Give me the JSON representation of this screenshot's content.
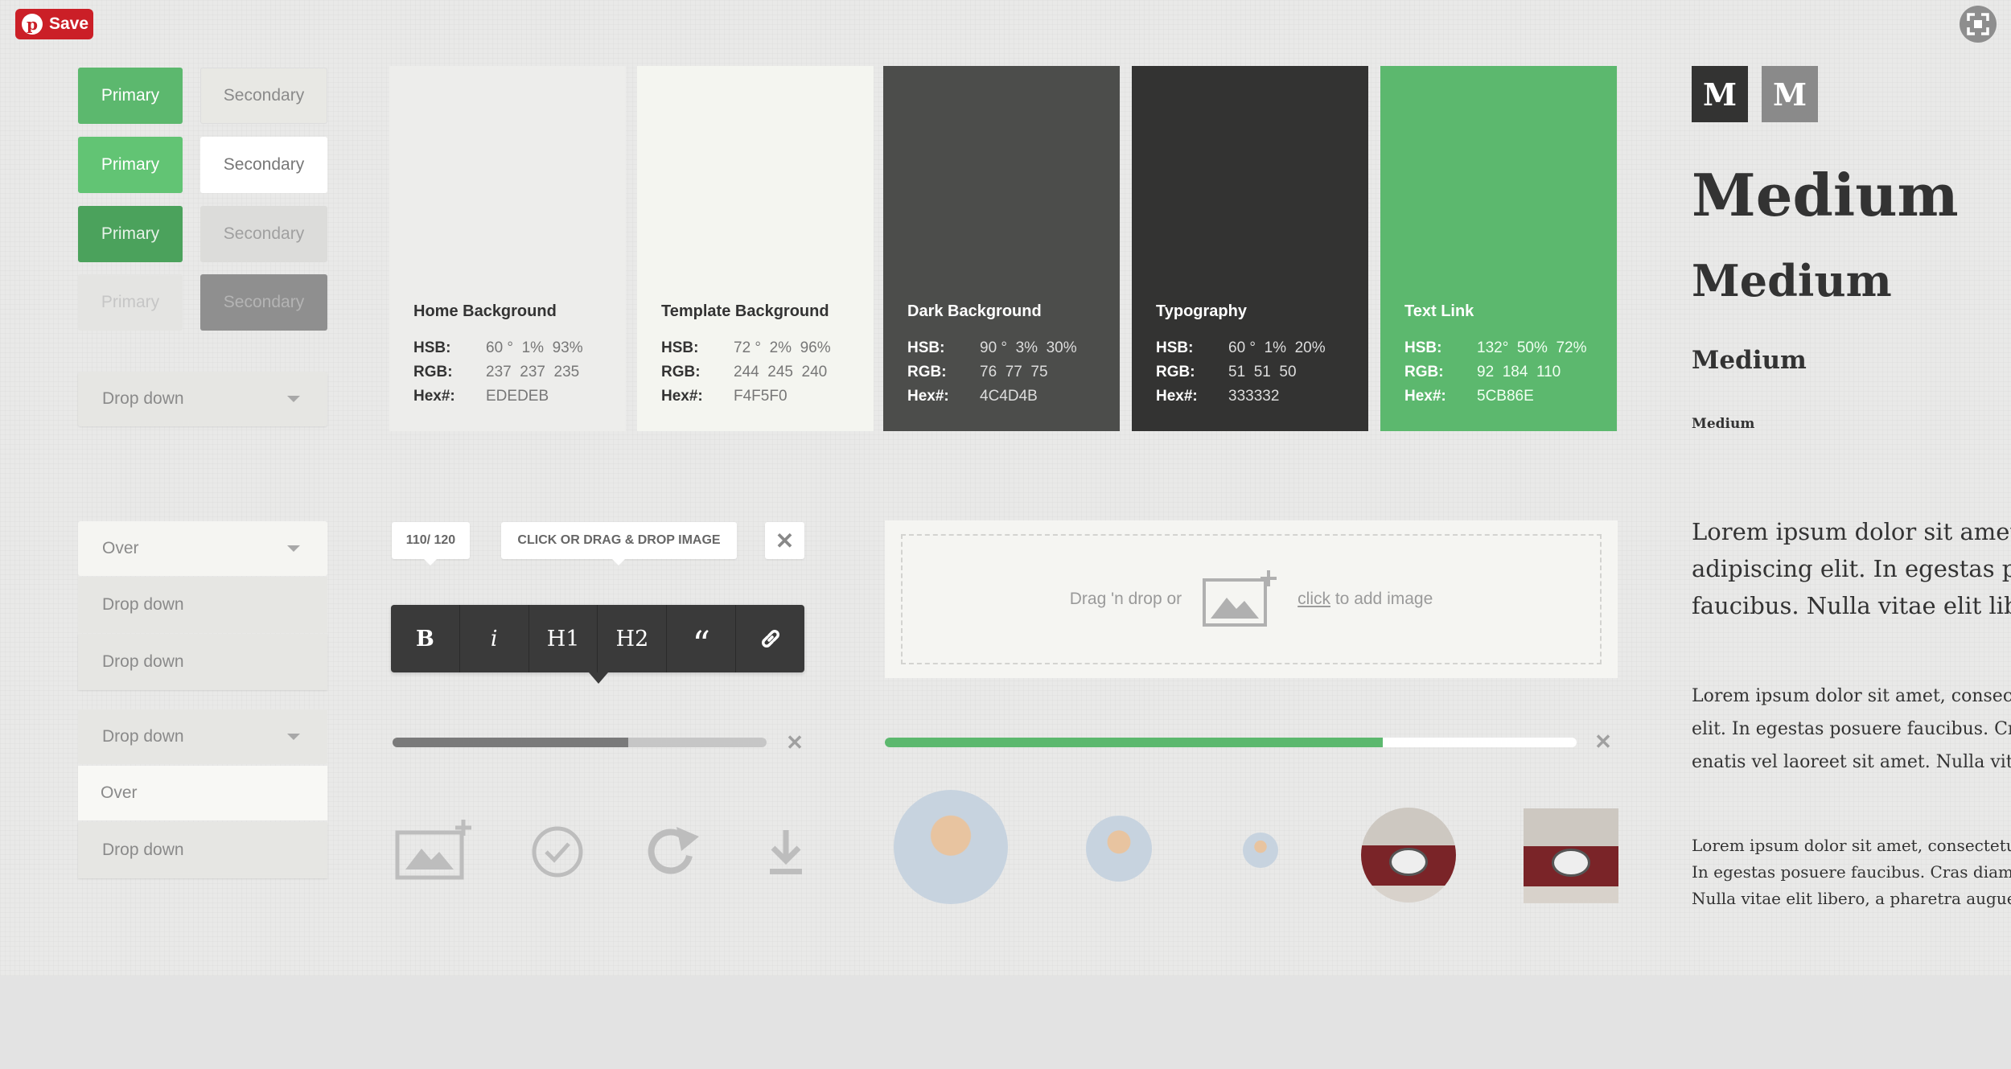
{
  "pinterest": {
    "save_label": "Save"
  },
  "buttons": [
    {
      "primary": "Primary",
      "secondary": "Secondary"
    },
    {
      "primary": "Primary",
      "secondary": "Secondary"
    },
    {
      "primary": "Primary",
      "secondary": "Secondary"
    },
    {
      "primary": "Primary",
      "secondary": "Secondary"
    }
  ],
  "dropdowns": {
    "closed": "Drop down",
    "open_a": {
      "header": "Over",
      "items": [
        "Drop down",
        "Drop down"
      ]
    },
    "open_b": {
      "header": "Drop down",
      "items": [
        "Over",
        "Drop down"
      ]
    }
  },
  "swatches": [
    {
      "name": "Home Background",
      "hsb": "60 °  1%  93%",
      "rgb": "237  237  235",
      "hex": "EDEDEB",
      "color": "#EDEDEB"
    },
    {
      "name": "Template Background",
      "hsb": "72 °  2%  96%",
      "rgb": "244  245  240",
      "hex": "F4F5F0",
      "color": "#F4F5F0"
    },
    {
      "name": "Dark Background",
      "hsb": "90 °  3%  30%",
      "rgb": "76  77  75",
      "hex": "4C4D4B",
      "color": "#4C4D4B"
    },
    {
      "name": "Typography",
      "hsb": "60 °  1%  20%",
      "rgb": "51  51  50",
      "hex": "333332",
      "color": "#333332"
    },
    {
      "name": "Text Link",
      "hsb": "132°  50%  72%",
      "rgb": "92  184  110",
      "hex": "5CB86E",
      "color": "#5CB86E"
    }
  ],
  "swatch_labels": {
    "hsb": "HSB:",
    "rgb": "RGB:",
    "hex": "Hex#:"
  },
  "typography": {
    "logo_letter": "M",
    "headings": [
      "Medium",
      "Medium",
      "Medium",
      "Medium"
    ],
    "paragraphs": [
      "Lorem ipsum dolor sit amet, c",
      "adipiscing elit. In egestas pos",
      "faucibus. Nulla vitae elit liber"
    ],
    "paragraphs_md": [
      "Lorem ipsum dolor sit amet, consecte",
      "elit. In egestas posuere faucibus. Cra",
      "enatis vel laoreet sit amet. Nulla vita"
    ],
    "paragraphs_sm": [
      "Lorem ipsum dolor sit amet, consectetu",
      "In egestas posuere faucibus. Cras diam",
      "Nulla vitae elit libero, a pharetra augue"
    ]
  },
  "editor": {
    "counter": "110/ 120",
    "upload_hint": "CLICK OR DRAG & DROP IMAGE",
    "toolbar": [
      "B",
      "i",
      "H1",
      "H2",
      "“",
      "link"
    ]
  },
  "dropzone": {
    "before": "Drag 'n drop or",
    "link": "click",
    "after": "to add image"
  },
  "progress": {
    "gray": 0.63,
    "green": 0.72
  },
  "colors": {
    "green": "#5CB86E",
    "green_hover": "#62C474",
    "green_active": "#4BA25C",
    "dark_bg": "#3A3A3A",
    "pin_red": "#CB1F27"
  }
}
